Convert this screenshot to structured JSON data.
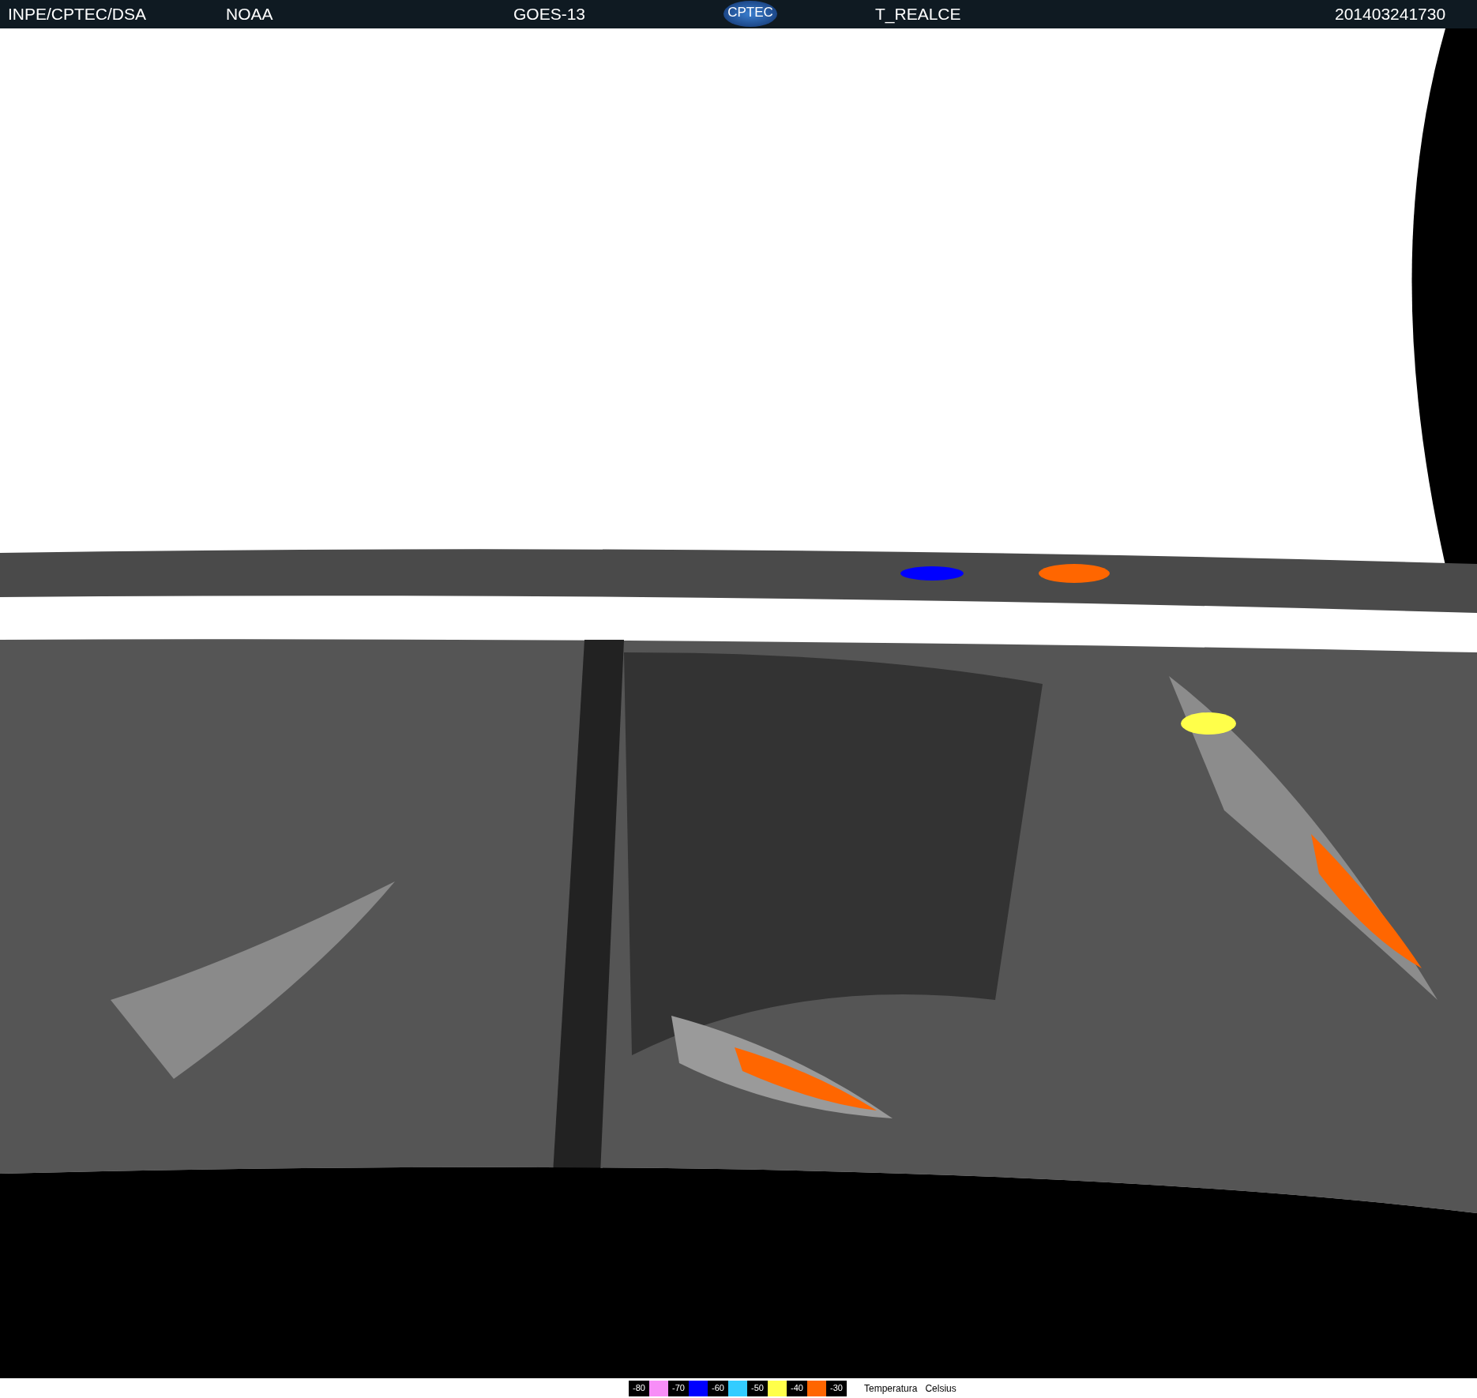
{
  "header": {
    "source": "INPE/CPTEC/DSA",
    "agency": "NOAA",
    "satellite": "GOES-13",
    "logo": "CPTEC",
    "product": "T_REALCE",
    "timestamp": "201403241730"
  },
  "legend": {
    "items": [
      {
        "label": "-80",
        "color": "#f78ef7"
      },
      {
        "label": "-70",
        "color": "#0000ff"
      },
      {
        "label": "-60",
        "color": "#33ccff"
      },
      {
        "label": "-50",
        "color": "#ffff4a"
      },
      {
        "label": "-40",
        "color": "#ff6600"
      },
      {
        "label": "-30"
      }
    ],
    "title": "Temperatura",
    "unit": "Celsius"
  }
}
